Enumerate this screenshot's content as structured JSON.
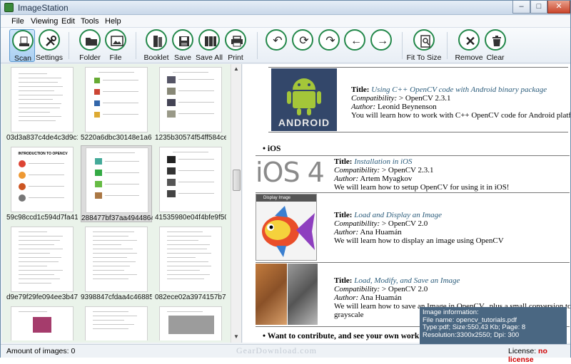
{
  "window": {
    "title": "ImageStation"
  },
  "menu": [
    "File",
    "Viewing",
    "Edit",
    "Tools",
    "Help"
  ],
  "toolbar": {
    "scan": "Scan",
    "settings": "Settings",
    "folder": "Folder",
    "file": "File",
    "booklet": "Booklet",
    "save": "Save",
    "save_all": "Save All",
    "print": "Print",
    "fit": "Fit To Size",
    "remove": "Remove",
    "clear": "Clear"
  },
  "thumbnails": [
    "03d3a837c4de4c3d9c1...",
    "5220a6dbc30148e1a66...",
    "1235b30574f54ff584ce2...",
    "59c98ccd1c594d7fa41c...",
    "288477bf37aa49448645...",
    "41535980e04f4bfe9f50d...",
    "d9e79f29fe094ee3b475...",
    "9398847cfdaa4c468853...",
    "082ece02a3974157b7d..."
  ],
  "thumb_page_header": "INTRODUCTION TO OPENCV",
  "doc": {
    "android": {
      "title_label": "Title:",
      "title": "Using C++ OpenCV code with Android binary package",
      "compat_label": "Compatibility:",
      "compat": "> OpenCV 2.3.1",
      "author_label": "Author:",
      "author": "Leonid Beynenson",
      "desc": "You will learn how to work with C++ OpenCV code for Android platform",
      "logo_text": "ANDROID"
    },
    "ios_bullet": "iOS",
    "ios": {
      "title_label": "Title:",
      "title": "Installation in iOS",
      "compat_label": "Compatibility:",
      "compat": "> OpenCV 2.3.1",
      "author_label": "Author:",
      "author": "Artem Myagkov",
      "desc": "We will learn how to setup OpenCV for using it in iOS!",
      "logo_text": "iOS 4"
    },
    "display": {
      "title_label": "Title:",
      "title": "Load and Display an Image",
      "compat_label": "Compatibility:",
      "compat": "> OpenCV 2.0",
      "author_label": "Author:",
      "author": "Ana Huamán",
      "desc": "We will learn how to display an image using OpenCV",
      "window_caption": "Display Image"
    },
    "modify": {
      "title_label": "Title:",
      "title": "Load, Modify, and Save an Image",
      "compat_label": "Compatibility:",
      "compat": "> OpenCV 2.0",
      "author_label": "Author:",
      "author": "Ana Huamán",
      "desc": "We will learn how to save an Image in OpenCV...plus a small conversion to",
      "desc2": "grayscale"
    },
    "contribute": "Want to contribute, and see your own work between the OpenCV tutorials?"
  },
  "info": {
    "heading": "Image information:",
    "file": "File name: opencv_tutorials.pdf",
    "type": "Type:pdf; Size:550,43 Kb; Page: 8",
    "res": "Resolution:3300x2550; Dpi: 300"
  },
  "status": {
    "amount_label": "Amount of images:",
    "amount": "0",
    "license_label": "License:",
    "license": "no license"
  },
  "watermark": "GearDownload.com",
  "colors": {
    "accent": "#23884a",
    "selection": "#a9cff2",
    "info_bg": "#4a6782"
  }
}
